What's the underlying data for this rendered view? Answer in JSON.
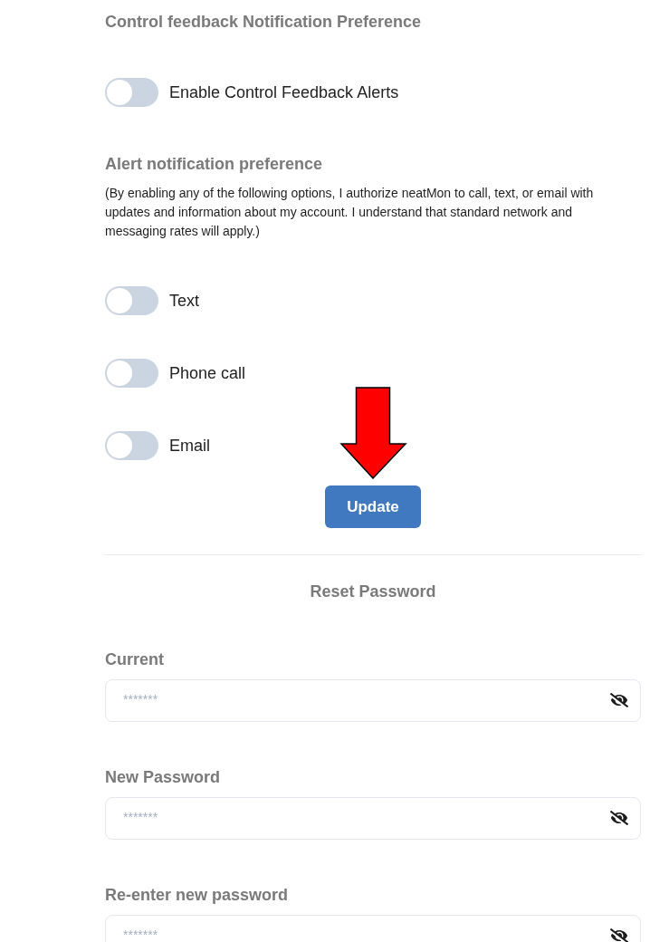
{
  "control_feedback": {
    "title": "Control feedback Notification Preference",
    "toggles": [
      {
        "label": "Enable Control Feedback Alerts",
        "on": false
      }
    ]
  },
  "alert_preference": {
    "title": "Alert notification preference",
    "description": "(By enabling any of the following options, I authorize neatMon to call, text, or email with updates and information about my account. I understand that standard network and messaging rates will apply.)",
    "toggles": [
      {
        "label": "Text",
        "on": false
      },
      {
        "label": "Phone call",
        "on": false
      },
      {
        "label": "Email",
        "on": false
      }
    ]
  },
  "update_button": {
    "label": "Update"
  },
  "reset_password": {
    "title": "Reset Password",
    "fields": [
      {
        "label": "Current",
        "placeholder": "*******"
      },
      {
        "label": "New Password",
        "placeholder": "*******"
      },
      {
        "label": "Re-enter new password",
        "placeholder": "*******"
      }
    ]
  }
}
